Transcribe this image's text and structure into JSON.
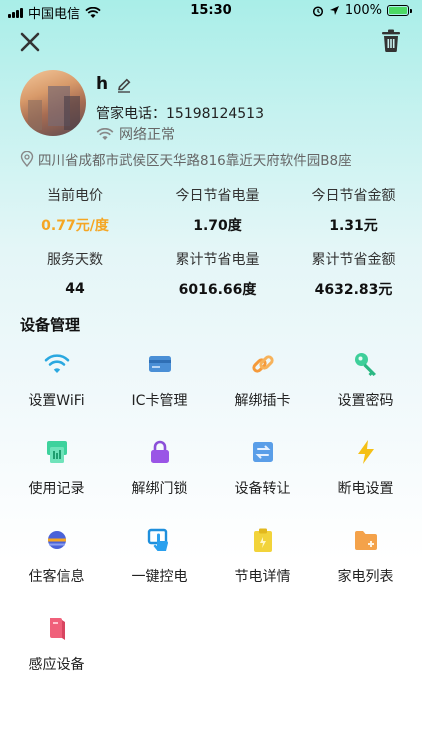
{
  "status_bar": {
    "carrier": "中国电信",
    "time": "15:30",
    "battery": "100%"
  },
  "profile": {
    "name": "h",
    "phone_label": "管家电话：",
    "phone": "15198124513",
    "network_status": "网络正常"
  },
  "address": "四川省成都市武侯区天华路816靠近天府软件园B8座",
  "stats": {
    "row1_labels": [
      "当前电价",
      "今日节省电量",
      "今日节省金额"
    ],
    "row1_values": [
      "0.77元/度",
      "1.70度",
      "1.31元"
    ],
    "row2_labels": [
      "服务天数",
      "累计节省电量",
      "累计节省金额"
    ],
    "row2_values": [
      "44",
      "6016.66度",
      "4632.83元"
    ],
    "accent_color": "#f5a623"
  },
  "section_title": "设备管理",
  "devices": [
    {
      "label": "设置WiFi",
      "icon": "wifi-icon"
    },
    {
      "label": "IC卡管理",
      "icon": "card-icon"
    },
    {
      "label": "解绑插卡",
      "icon": "link-icon"
    },
    {
      "label": "设置密码",
      "icon": "key-icon"
    },
    {
      "label": "使用记录",
      "icon": "record-icon"
    },
    {
      "label": "解绑门锁",
      "icon": "lock-icon"
    },
    {
      "label": "设备转让",
      "icon": "transfer-icon"
    },
    {
      "label": "断电设置",
      "icon": "lightning-icon"
    },
    {
      "label": "住客信息",
      "icon": "guest-icon"
    },
    {
      "label": "一键控电",
      "icon": "touch-icon"
    },
    {
      "label": "节电详情",
      "icon": "clipboard-icon"
    },
    {
      "label": "家电列表",
      "icon": "folder-icon"
    },
    {
      "label": "感应设备",
      "icon": "sensor-icon"
    }
  ]
}
